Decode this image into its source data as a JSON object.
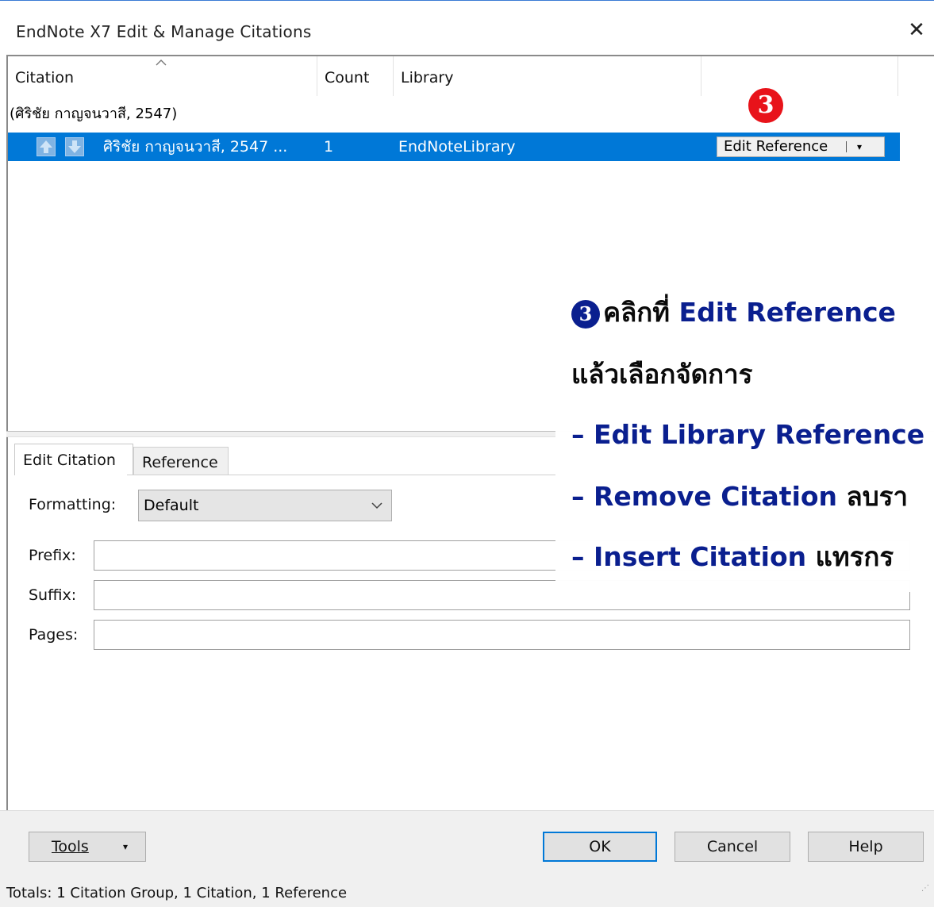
{
  "window": {
    "title": "EndNote X7 Edit & Manage Citations",
    "close_glyph": "✕"
  },
  "list": {
    "columns": [
      "Citation",
      "Count",
      "Library"
    ],
    "sort_indicator": "^",
    "group_label": "(ศิริชัย กาญจนวาสี, 2547)",
    "selected_row": {
      "citation": "ศิริชัย กาญจนวาสี, 2547 ...",
      "count": "1",
      "library": "EndNoteLibrary",
      "action_button": "Edit Reference",
      "action_caret": "▾"
    },
    "marker": "3"
  },
  "edit_panel": {
    "tabs": [
      "Edit Citation",
      "Reference"
    ],
    "formatting_label": "Formatting:",
    "formatting_value": "Default",
    "prefix_label": "Prefix:",
    "suffix_label": "Suffix:",
    "pages_label": "Pages:",
    "prefix_value": "",
    "suffix_value": "",
    "pages_value": ""
  },
  "buttons": {
    "tools": "Tools",
    "ok": "OK",
    "cancel": "Cancel",
    "help": "Help"
  },
  "status": "Totals: 1 Citation Group, 1 Citation, 1 Reference",
  "annotation": {
    "marker": "3",
    "line1_thai": "คลิกที่ ",
    "line1_en": "Edit Reference",
    "line2": "แล้วเลือกจัดการ",
    "line3": "– Edit Library Reference",
    "line4_en": "– Remove Citation ",
    "line4_thai": "ลบรา",
    "line5_en": "– Insert Citation ",
    "line5_thai": "แทรกร"
  },
  "colors": {
    "selection": "#0078d7",
    "marker_red": "#e8131a",
    "annotation_blue": "#0a1f8f"
  }
}
